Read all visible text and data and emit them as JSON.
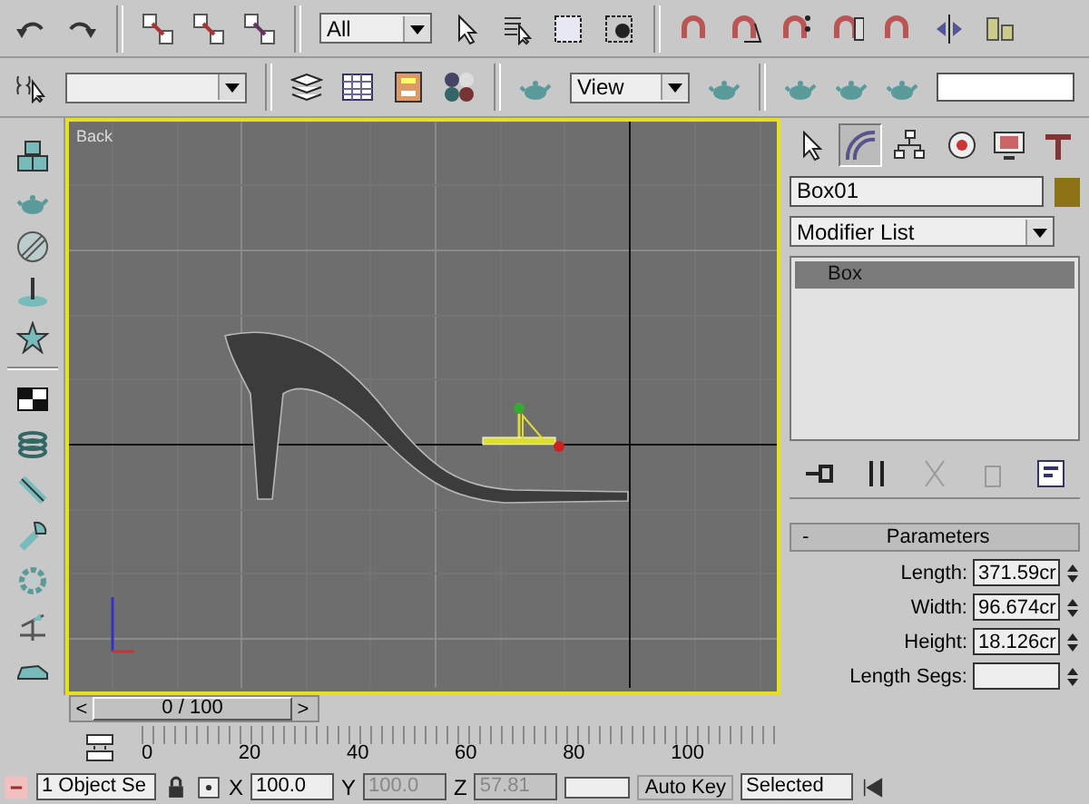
{
  "toolbar_main": {
    "selection_filter": "All"
  },
  "toolbar_second": {
    "view_dropdown": "View"
  },
  "viewport": {
    "label": "Back"
  },
  "command_panel": {
    "tabs": [
      {
        "selected": false
      },
      {
        "selected": true
      },
      {
        "selected": false
      },
      {
        "selected": false
      },
      {
        "selected": false
      },
      {
        "selected": false
      }
    ],
    "object": {
      "name": "Box01",
      "color": "#8c7416"
    },
    "modifier_list": "Modifier List",
    "stack": [
      {
        "label": "Box",
        "selected": true
      }
    ],
    "rollout": {
      "collapse": "-",
      "title": "Parameters",
      "fields": [
        {
          "label": "Length:",
          "value": "371.59cr"
        },
        {
          "label": "Width:",
          "value": "96.674cr"
        },
        {
          "label": "Height:",
          "value": "18.126cr"
        },
        {
          "label": "Length Segs:"
        }
      ]
    }
  },
  "time_slider": {
    "prev": "<",
    "position": "0 / 100",
    "next": ">"
  },
  "track_bar": {
    "ticks": [
      "0",
      "20",
      "40",
      "60",
      "80",
      "100"
    ]
  },
  "status_bar": {
    "selection": "1 Object Se",
    "coords": [
      {
        "axis": "X",
        "value": "100.0",
        "disabled": false
      },
      {
        "axis": "Y",
        "value": "100.0",
        "disabled": true
      },
      {
        "axis": "Z",
        "value": "57.81",
        "disabled": true
      }
    ],
    "auto_key": "Auto Key",
    "key_filter": "Selected"
  }
}
